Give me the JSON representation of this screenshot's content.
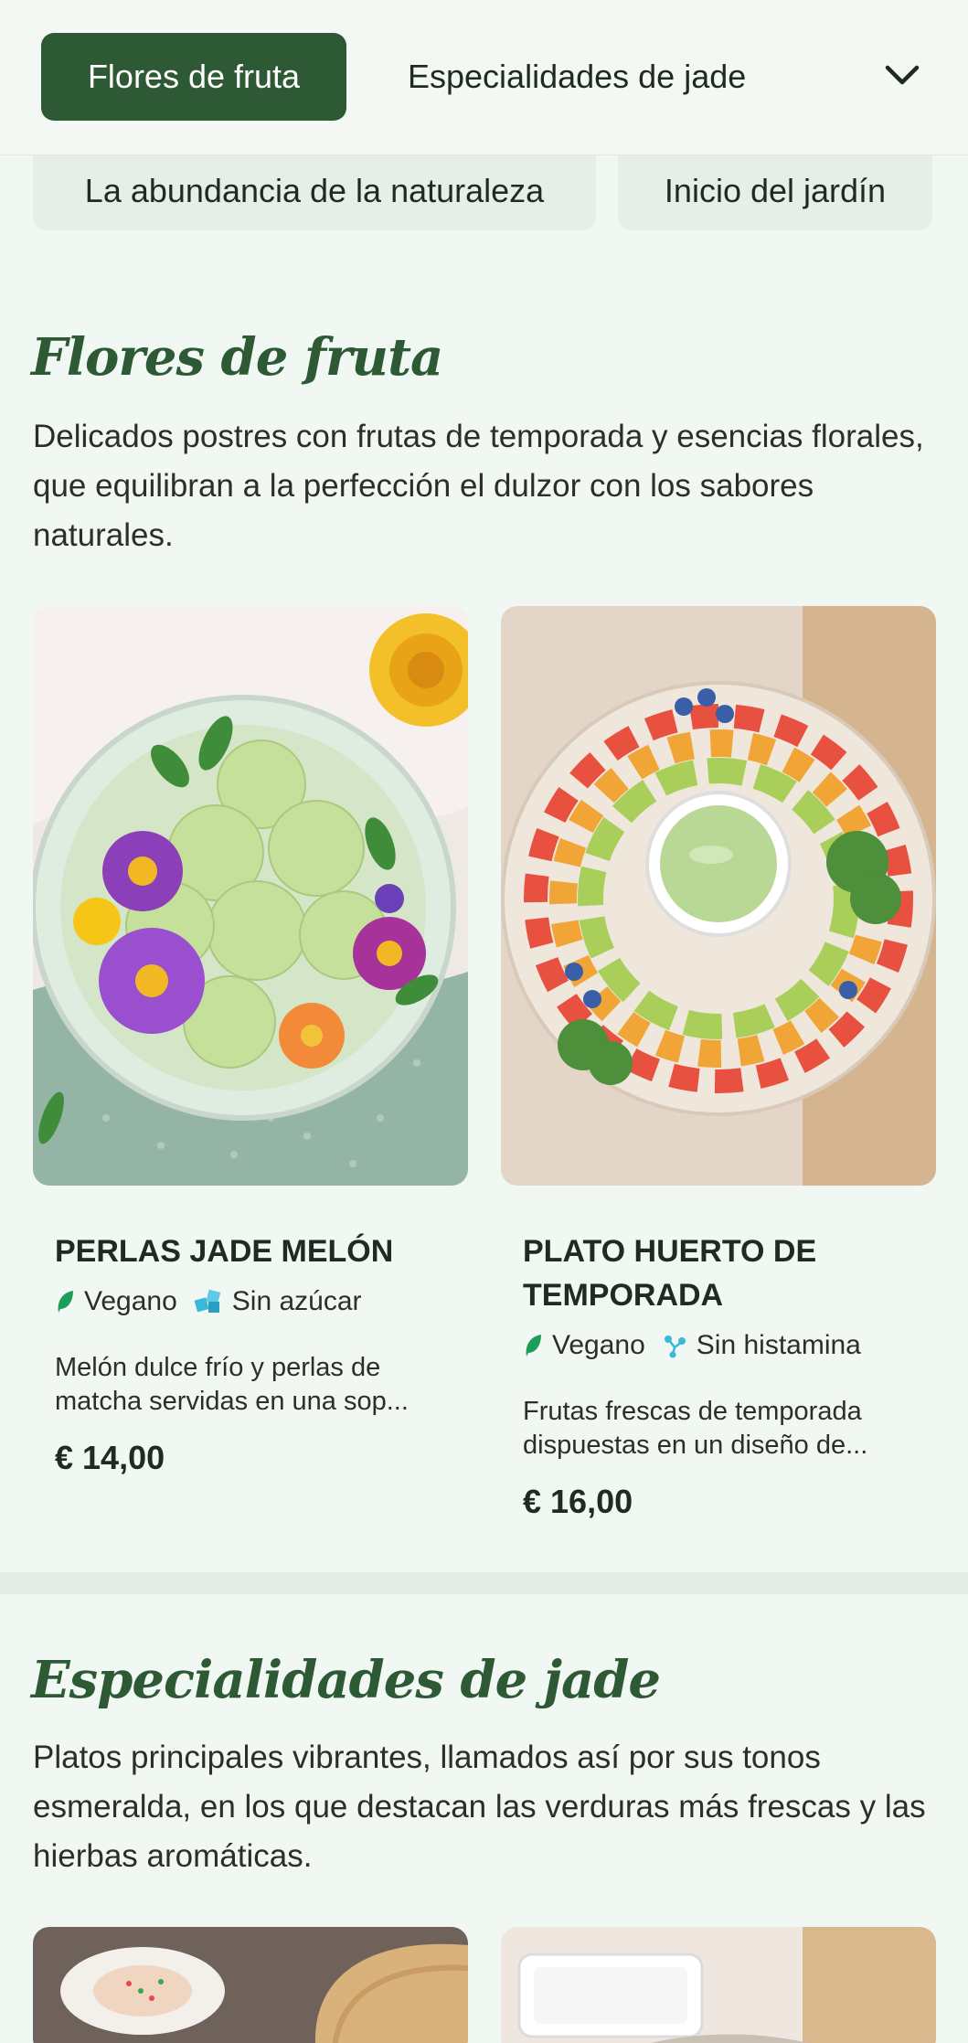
{
  "nav": {
    "active_tab": "Flores de fruta",
    "tab_2": "Especialidades de jade",
    "chevron_icon": "chevron-down-icon",
    "pill_1": "La abundancia de la naturaleza",
    "pill_2": "Inicio del jardín"
  },
  "sections": [
    {
      "title": "Flores de fruta",
      "description": "Delicados postres con frutas de temporada y esencias florales, que equilibran a la perfección el dulzor con los sabores naturales.",
      "items": [
        {
          "name": "Perlas jade melón",
          "tags": [
            {
              "label": "Vegano",
              "icon": "leaf-icon"
            },
            {
              "label": "Sin azúcar",
              "icon": "sugar-cubes-icon"
            }
          ],
          "description": "Melón dulce frío y perlas de matcha servidas en una sop...",
          "price": "€ 14,00"
        },
        {
          "name": "Plato huerto de temporada",
          "tags": [
            {
              "label": "Vegano",
              "icon": "leaf-icon"
            },
            {
              "label": "Sin histamina",
              "icon": "molecule-icon"
            }
          ],
          "description": "Frutas frescas de temporada dispuestas en un diseño de...",
          "price": "€ 16,00"
        }
      ]
    },
    {
      "title": "Especialidades de jade",
      "description": "Platos principales vibrantes, llamados así por sus tonos esmeralda, en los que destacan las verduras más frescas y las hierbas aromáticas."
    }
  ],
  "colors": {
    "brand_green": "#2d5a35",
    "background": "#f1f7f2",
    "vegan_icon": "#1a9e5a",
    "tag_icon_blue": "#3bb7d8"
  }
}
